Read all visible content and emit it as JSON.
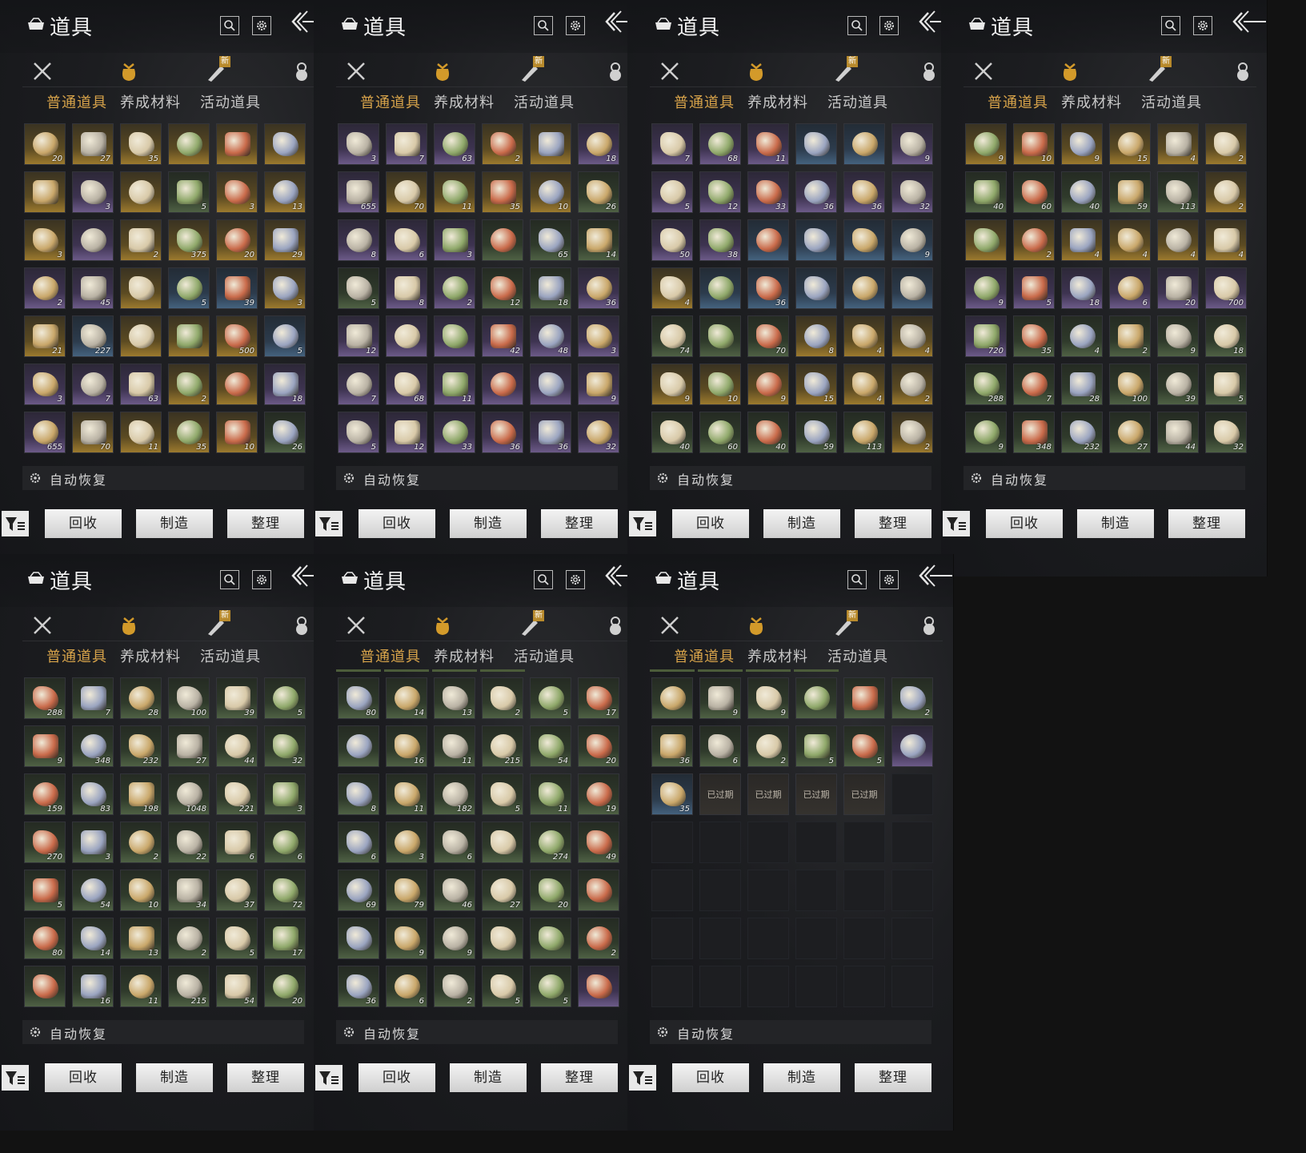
{
  "window": {
    "title": "道具"
  },
  "subtabs": [
    "普通道具",
    "养成材料",
    "活动道具"
  ],
  "new_badge": "新",
  "auto_restore_label": "自动恢复",
  "buttons": {
    "recycle": "回收",
    "craft": "制造",
    "sort": "整理"
  },
  "rarity_colors": {
    "gold": "#9c7a2e",
    "purple": "#6c5a88",
    "blue": "#44627e",
    "green": "#4f6144"
  },
  "panels": [
    {
      "rows": [
        [
          [
            "gold",
            "20"
          ],
          [
            "gold",
            "27"
          ],
          [
            "gold",
            "35"
          ],
          [
            "gold",
            ""
          ],
          [
            "gold",
            ""
          ],
          [
            "gold",
            ""
          ]
        ],
        [
          [
            "gold",
            ""
          ],
          [
            "purple",
            "3"
          ],
          [
            "gold",
            ""
          ],
          [
            "green",
            "5"
          ],
          [
            "gold",
            "3"
          ],
          [
            "gold",
            "13"
          ]
        ],
        [
          [
            "gold",
            "3"
          ],
          [
            "purple",
            ""
          ],
          [
            "gold",
            "2"
          ],
          [
            "gold",
            "375"
          ],
          [
            "gold",
            "20"
          ],
          [
            "gold",
            "29"
          ]
        ],
        [
          [
            "purple",
            "2"
          ],
          [
            "purple",
            "45"
          ],
          [
            "gold",
            ""
          ],
          [
            "blue",
            "5"
          ],
          [
            "blue",
            "39"
          ],
          [
            "gold",
            "3"
          ]
        ],
        [
          [
            "gold",
            "21"
          ],
          [
            "blue",
            "227"
          ],
          [
            "gold",
            ""
          ],
          [
            "gold",
            ""
          ],
          [
            "gold",
            "500"
          ],
          [
            "blue",
            "5"
          ]
        ],
        [
          [
            "purple",
            "3"
          ],
          [
            "purple",
            "7"
          ],
          [
            "purple",
            "63"
          ],
          [
            "gold",
            "2"
          ],
          [
            "gold",
            ""
          ],
          [
            "purple",
            "18"
          ]
        ],
        [
          [
            "purple",
            "655"
          ],
          [
            "gold",
            "70"
          ],
          [
            "gold",
            "11"
          ],
          [
            "gold",
            "35"
          ],
          [
            "gold",
            "10"
          ],
          [
            "green",
            "26"
          ]
        ]
      ]
    },
    {
      "rows": [
        [
          [
            "purple",
            "3"
          ],
          [
            "purple",
            "7"
          ],
          [
            "purple",
            "63"
          ],
          [
            "gold",
            "2"
          ],
          [
            "gold",
            ""
          ],
          [
            "purple",
            "18"
          ]
        ],
        [
          [
            "purple",
            "655"
          ],
          [
            "gold",
            "70"
          ],
          [
            "gold",
            "11"
          ],
          [
            "gold",
            "35"
          ],
          [
            "gold",
            "10"
          ],
          [
            "green",
            "26"
          ]
        ],
        [
          [
            "purple",
            "8"
          ],
          [
            "purple",
            "6"
          ],
          [
            "purple",
            "3"
          ],
          [
            "green",
            ""
          ],
          [
            "green",
            "65"
          ],
          [
            "green",
            "14"
          ]
        ],
        [
          [
            "green",
            "5"
          ],
          [
            "purple",
            "8"
          ],
          [
            "purple",
            "2"
          ],
          [
            "green",
            "12"
          ],
          [
            "green",
            "18"
          ],
          [
            "purple",
            "36"
          ]
        ],
        [
          [
            "purple",
            "12"
          ],
          [
            "purple",
            ""
          ],
          [
            "purple",
            ""
          ],
          [
            "purple",
            "42"
          ],
          [
            "purple",
            "48"
          ],
          [
            "purple",
            "3"
          ]
        ],
        [
          [
            "purple",
            "7"
          ],
          [
            "purple",
            "68"
          ],
          [
            "purple",
            "11"
          ],
          [
            "purple",
            ""
          ],
          [
            "purple",
            ""
          ],
          [
            "purple",
            "9"
          ]
        ],
        [
          [
            "purple",
            "5"
          ],
          [
            "purple",
            "12"
          ],
          [
            "purple",
            "33"
          ],
          [
            "purple",
            "36"
          ],
          [
            "purple",
            "36"
          ],
          [
            "purple",
            "32"
          ]
        ]
      ]
    },
    {
      "rows": [
        [
          [
            "purple",
            "7"
          ],
          [
            "purple",
            "68"
          ],
          [
            "purple",
            "11"
          ],
          [
            "blue",
            ""
          ],
          [
            "blue",
            ""
          ],
          [
            "purple",
            "9"
          ]
        ],
        [
          [
            "purple",
            "5"
          ],
          [
            "purple",
            "12"
          ],
          [
            "purple",
            "33"
          ],
          [
            "purple",
            "36"
          ],
          [
            "purple",
            "36"
          ],
          [
            "purple",
            "32"
          ]
        ],
        [
          [
            "purple",
            "50"
          ],
          [
            "purple",
            "38"
          ],
          [
            "blue",
            ""
          ],
          [
            "blue",
            ""
          ],
          [
            "blue",
            ""
          ],
          [
            "blue",
            "9"
          ]
        ],
        [
          [
            "gold",
            "4"
          ],
          [
            "blue",
            ""
          ],
          [
            "blue",
            "36"
          ],
          [
            "blue",
            ""
          ],
          [
            "blue",
            ""
          ],
          [
            "blue",
            ""
          ]
        ],
        [
          [
            "green",
            "74"
          ],
          [
            "green",
            ""
          ],
          [
            "green",
            "70"
          ],
          [
            "gold",
            "8"
          ],
          [
            "gold",
            "4"
          ],
          [
            "gold",
            "4"
          ]
        ],
        [
          [
            "gold",
            "9"
          ],
          [
            "gold",
            "10"
          ],
          [
            "gold",
            "9"
          ],
          [
            "gold",
            "15"
          ],
          [
            "gold",
            "4"
          ],
          [
            "gold",
            "2"
          ]
        ],
        [
          [
            "green",
            "40"
          ],
          [
            "green",
            "60"
          ],
          [
            "green",
            "40"
          ],
          [
            "green",
            "59"
          ],
          [
            "green",
            "113"
          ],
          [
            "gold",
            "2"
          ]
        ]
      ]
    },
    {
      "rows": [
        [
          [
            "gold",
            "9"
          ],
          [
            "gold",
            "10"
          ],
          [
            "gold",
            "9"
          ],
          [
            "gold",
            "15"
          ],
          [
            "gold",
            "4"
          ],
          [
            "gold",
            "2"
          ]
        ],
        [
          [
            "green",
            "40"
          ],
          [
            "green",
            "60"
          ],
          [
            "green",
            "40"
          ],
          [
            "green",
            "59"
          ],
          [
            "green",
            "113"
          ],
          [
            "gold",
            "2"
          ]
        ],
        [
          [
            "gold",
            ""
          ],
          [
            "gold",
            "2"
          ],
          [
            "gold",
            "4"
          ],
          [
            "gold",
            "4"
          ],
          [
            "gold",
            "4"
          ],
          [
            "gold",
            "4"
          ]
        ],
        [
          [
            "purple",
            "9"
          ],
          [
            "purple",
            "5"
          ],
          [
            "purple",
            "18"
          ],
          [
            "purple",
            "6"
          ],
          [
            "purple",
            "20"
          ],
          [
            "purple",
            "700"
          ]
        ],
        [
          [
            "purple",
            "720"
          ],
          [
            "green",
            "35"
          ],
          [
            "green",
            "4"
          ],
          [
            "green",
            "2"
          ],
          [
            "green",
            "9"
          ],
          [
            "green",
            "18"
          ]
        ],
        [
          [
            "green",
            "288"
          ],
          [
            "green",
            "7"
          ],
          [
            "green",
            "28"
          ],
          [
            "green",
            "100"
          ],
          [
            "green",
            "39"
          ],
          [
            "green",
            "5"
          ]
        ],
        [
          [
            "green",
            "9"
          ],
          [
            "green",
            "348"
          ],
          [
            "green",
            "232"
          ],
          [
            "green",
            "27"
          ],
          [
            "green",
            "44"
          ],
          [
            "green",
            "32"
          ]
        ]
      ]
    },
    {
      "rows": [
        [
          [
            "green",
            "288"
          ],
          [
            "green",
            "7"
          ],
          [
            "green",
            "28"
          ],
          [
            "green",
            "100"
          ],
          [
            "green",
            "39"
          ],
          [
            "green",
            "5"
          ]
        ],
        [
          [
            "green",
            "9"
          ],
          [
            "green",
            "348"
          ],
          [
            "green",
            "232"
          ],
          [
            "green",
            "27"
          ],
          [
            "green",
            "44"
          ],
          [
            "green",
            "32"
          ]
        ],
        [
          [
            "green",
            "159"
          ],
          [
            "green",
            "83"
          ],
          [
            "green",
            "198"
          ],
          [
            "green",
            "1048"
          ],
          [
            "green",
            "221"
          ],
          [
            "green",
            "3"
          ]
        ],
        [
          [
            "green",
            "270"
          ],
          [
            "green",
            "3"
          ],
          [
            "green",
            "2"
          ],
          [
            "green",
            "22"
          ],
          [
            "green",
            "6"
          ],
          [
            "green",
            "6"
          ]
        ],
        [
          [
            "green",
            "5"
          ],
          [
            "green",
            "54"
          ],
          [
            "green",
            "10"
          ],
          [
            "green",
            "34"
          ],
          [
            "green",
            "37"
          ],
          [
            "green",
            "72"
          ]
        ],
        [
          [
            "green",
            "80"
          ],
          [
            "green",
            "14"
          ],
          [
            "green",
            "13"
          ],
          [
            "green",
            "2"
          ],
          [
            "green",
            "5"
          ],
          [
            "green",
            "17"
          ]
        ],
        [
          [
            "green",
            ""
          ],
          [
            "green",
            "16"
          ],
          [
            "green",
            "11"
          ],
          [
            "green",
            "215"
          ],
          [
            "green",
            "54"
          ],
          [
            "green",
            "20"
          ]
        ]
      ]
    },
    {
      "rows": [
        [
          [
            "green",
            "80"
          ],
          [
            "green",
            "14"
          ],
          [
            "green",
            "13"
          ],
          [
            "green",
            "2"
          ],
          [
            "green",
            "5"
          ],
          [
            "green",
            "17"
          ]
        ],
        [
          [
            "green",
            ""
          ],
          [
            "green",
            "16"
          ],
          [
            "green",
            "11"
          ],
          [
            "green",
            "215"
          ],
          [
            "green",
            "54"
          ],
          [
            "green",
            "20"
          ]
        ],
        [
          [
            "green",
            "8"
          ],
          [
            "green",
            "11"
          ],
          [
            "green",
            "182"
          ],
          [
            "green",
            "5"
          ],
          [
            "green",
            "11"
          ],
          [
            "green",
            "19"
          ]
        ],
        [
          [
            "green",
            "6"
          ],
          [
            "green",
            "3"
          ],
          [
            "green",
            "6"
          ],
          [
            "green",
            ""
          ],
          [
            "green",
            "274"
          ],
          [
            "green",
            "49"
          ]
        ],
        [
          [
            "green",
            "69"
          ],
          [
            "green",
            "79"
          ],
          [
            "green",
            "46"
          ],
          [
            "green",
            "27"
          ],
          [
            "green",
            "20"
          ],
          [
            "green",
            ""
          ]
        ],
        [
          [
            "green",
            ""
          ],
          [
            "green",
            "9"
          ],
          [
            "green",
            "9"
          ],
          [
            "green",
            ""
          ],
          [
            "green",
            ""
          ],
          [
            "green",
            "2"
          ]
        ],
        [
          [
            "green",
            "36"
          ],
          [
            "green",
            "6"
          ],
          [
            "green",
            "2"
          ],
          [
            "green",
            "5"
          ],
          [
            "green",
            "5"
          ],
          [
            "purple",
            ""
          ]
        ]
      ]
    },
    {
      "rows": [
        [
          [
            "green",
            ""
          ],
          [
            "green",
            "9"
          ],
          [
            "green",
            "9"
          ],
          [
            "green",
            ""
          ],
          [
            "green",
            ""
          ],
          [
            "green",
            "2"
          ]
        ],
        [
          [
            "green",
            "36"
          ],
          [
            "green",
            "6"
          ],
          [
            "green",
            "2"
          ],
          [
            "green",
            "5"
          ],
          [
            "green",
            "5"
          ],
          [
            "purple",
            ""
          ]
        ],
        [
          [
            "blue",
            "35"
          ],
          [
            "expired",
            "已过期"
          ],
          [
            "expired",
            "已过期"
          ],
          [
            "expired",
            "已过期"
          ],
          [
            "expired",
            "已过期"
          ],
          [
            "empty",
            ""
          ]
        ],
        [
          [
            "empty",
            ""
          ],
          [
            "empty",
            ""
          ],
          [
            "empty",
            ""
          ],
          [
            "empty",
            ""
          ],
          [
            "empty",
            ""
          ],
          [
            "empty",
            ""
          ]
        ],
        [
          [
            "empty",
            ""
          ],
          [
            "empty",
            ""
          ],
          [
            "empty",
            ""
          ],
          [
            "empty",
            ""
          ],
          [
            "empty",
            ""
          ],
          [
            "empty",
            ""
          ]
        ],
        [
          [
            "empty",
            ""
          ],
          [
            "empty",
            ""
          ],
          [
            "empty",
            ""
          ],
          [
            "empty",
            ""
          ],
          [
            "empty",
            ""
          ],
          [
            "empty",
            ""
          ]
        ],
        [
          [
            "empty",
            ""
          ],
          [
            "empty",
            ""
          ],
          [
            "empty",
            ""
          ],
          [
            "empty",
            ""
          ],
          [
            "empty",
            ""
          ],
          [
            "empty",
            ""
          ]
        ]
      ]
    }
  ]
}
